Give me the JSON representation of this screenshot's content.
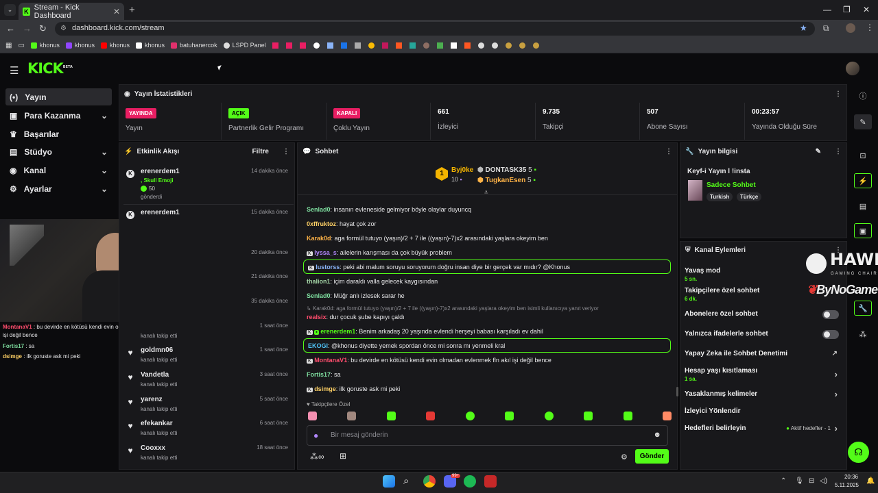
{
  "browser": {
    "tab_title": "Stream - Kick Dashboard",
    "url": "dashboard.kick.com/stream",
    "bookmarks": [
      {
        "label": "khonus",
        "color": "#53fc18"
      },
      {
        "label": "khonus",
        "color": "#9146ff"
      },
      {
        "label": "khonus",
        "color": "#ff0000"
      },
      {
        "label": "khonus",
        "color": "#ffffff"
      },
      {
        "label": "batuhanercok",
        "color": "#e1306c"
      },
      {
        "label": "LSPD Panel",
        "color": "#dddddd"
      }
    ]
  },
  "sidebar": {
    "items": [
      {
        "label": "Yayın",
        "icon": "broadcast-icon"
      },
      {
        "label": "Para Kazanma",
        "icon": "dollar-icon"
      },
      {
        "label": "Başarılar",
        "icon": "trophy-icon"
      },
      {
        "label": "Stüdyo",
        "icon": "studio-icon"
      },
      {
        "label": "Kanal",
        "icon": "user-icon"
      },
      {
        "label": "Ayarlar",
        "icon": "gear-icon"
      }
    ]
  },
  "logo": "KICK",
  "logo_sup": "BETA",
  "stats": {
    "title": "Yayın İstatistikleri",
    "cells": [
      {
        "badge": "YAYINDA",
        "badge_color": "#e91e63",
        "label": "Yayın"
      },
      {
        "badge": "AÇIK",
        "badge_color": "#53fc18",
        "label": "Partnerlik Gelir Programı"
      },
      {
        "badge": "KAPALI",
        "badge_color": "#e91e63",
        "label": "Çoklu Yayın"
      },
      {
        "value": "661",
        "label": "İzleyici"
      },
      {
        "value": "9.735",
        "label": "Takipçi"
      },
      {
        "value": "507",
        "label": "Abone Sayısı"
      },
      {
        "value": "00:23:57",
        "label": "Yayında Olduğu Süre"
      }
    ]
  },
  "activity": {
    "title": "Etkinlik Akışı",
    "filter": "Filtre",
    "items": [
      {
        "name": "erenerdem1",
        "time": "14 dakika önce",
        "sub": "gönderdi"
      },
      {
        "name": "erenerdem1",
        "time": "15 dakika önce",
        "sub": ""
      },
      {
        "name": "",
        "time": "20 dakika önce",
        "sub": ""
      },
      {
        "name": "",
        "time": "21 dakika önce",
        "sub": ""
      },
      {
        "name": "",
        "time": "35 dakika önce",
        "sub": ""
      },
      {
        "name": "",
        "time": "1 saat önce",
        "sub": "kanalı takip etti"
      },
      {
        "name": "goldmn06",
        "time": "1 saat önce",
        "sub": "kanalı takip etti"
      },
      {
        "name": "Vandetla",
        "time": "3 saat önce",
        "sub": "kanalı takip etti"
      },
      {
        "name": "yarenz",
        "time": "5 saat önce",
        "sub": "kanalı takip etti"
      },
      {
        "name": "efekankar",
        "time": "6 saat önce",
        "sub": "kanalı takip etti"
      },
      {
        "name": "Cooxxx",
        "time": "18 saat önce",
        "sub": "kanalı takip etti"
      }
    ],
    "gift_line": ", Skull Emoji",
    "gift_count": "50"
  },
  "chat": {
    "title": "Sohbet",
    "top": [
      {
        "rank": "1",
        "name": "Byj0ke",
        "count": "10"
      },
      {
        "name": "DONTASK35",
        "count": "5"
      },
      {
        "name": "TugkanEsen",
        "count": "5"
      }
    ],
    "messages": [
      {
        "user": "Senlad0",
        "color": "#7fdfa0",
        "text": "insanın evleneside gelmiyor böyle olaylar duyuncq",
        "hl": false
      },
      {
        "user": "0xffruktoz",
        "color": "#ffd166",
        "text": "hayat çok zor",
        "hl": false
      },
      {
        "user": "Karak0d",
        "color": "#ffb347",
        "text": "aga formül tutuyo (yaşın)/2 + 7 ile ((yaşın)-7)x2 arasındaki yaşlara okeyim ben",
        "hl": false
      },
      {
        "user": "lyssa_s",
        "color": "#b388ff",
        "text": "ailelerin karışması da çok büyük problem",
        "hl": false
      },
      {
        "user": "lustorss",
        "color": "#8ab4f8",
        "text": "peki abi malum soruyu soruyorum doğru insan diye bir gerçek var mıdır? @Khonus",
        "hl": true
      },
      {
        "user": "thalion1",
        "color": "#a5d6a7",
        "text": "içim daraldı valla gelecek kaygısından",
        "hl": false
      },
      {
        "user": "Senlad0",
        "color": "#7fdfa0",
        "text": "Müğr anlı izlesek sarar he",
        "hl": false
      },
      {
        "user": "realsix",
        "color": "#ff4d6d",
        "text": "dur çocuk şube kapıyı çaldı",
        "hl": false
      },
      {
        "user": "erenerdem1",
        "color": "#53fc18",
        "text": "Benim arkadaş 20 yaşında evlendi herşeyi babası karşıladı ev dahil",
        "hl": false
      },
      {
        "user": "EKOGI",
        "color": "#4fc3f7",
        "text": "@khonus diyette yemek spordan önce mi sonra mı yenmeli kral",
        "hl": true
      },
      {
        "user": "MontanaV1",
        "color": "#ff4d6d",
        "text": "bu devirde en kötüsü kendi evin olmadan evlenmek fln akıl işi değil bence",
        "hl": false
      },
      {
        "user": "Fortis17",
        "color": "#7fdfa0",
        "text": "sa",
        "hl": false
      },
      {
        "user": "dsimge",
        "color": "#ffd166",
        "text": "ilk goruste ask mi peki",
        "hl": false
      }
    ],
    "reply_preview": "Karak0d: aga formül tutuyo (yaşın)/2 + 7 ile ((yaşın)-7)x2 arasındaki yaşlara okeyim ben isimli kullanıcıya yanıt veriyor",
    "emote_header": "Takipçilere Özel",
    "input_placeholder": "Bir mesaj gönderin",
    "send": "Gönder"
  },
  "overlay_chat": [
    {
      "user": "MontanaV1",
      "color": "#ff4d6d",
      "text": "bu devirde en kötüsü kendi evin olmadan evlenmek fln akıl işi değil bence"
    },
    {
      "user": "Fortis17",
      "color": "#7fdfa0",
      "text": "sa"
    },
    {
      "user": "dsimge",
      "color": "#ffd166",
      "text": "ilk goruste ask mi peki"
    }
  ],
  "stream_info": {
    "title": "Yayın bilgisi",
    "stream_title": "Keyf-i Yayın l !insta",
    "category": "Sadece Sohbet",
    "tags": [
      "Turkish",
      "Türkçe"
    ]
  },
  "channel_actions": {
    "title": "Kanal Eylemleri",
    "items": [
      {
        "label": "Yavaş mod",
        "sub": "5 sn."
      },
      {
        "label": "Takipçilere özel sohbet",
        "sub": "6 dk."
      },
      {
        "label": "Abonelere özel sohbet",
        "sub": ""
      },
      {
        "label": "Yalnızca ifadelerle sohbet",
        "sub": ""
      },
      {
        "label": "Yapay Zeka ile Sohbet Denetimi",
        "sub": ""
      },
      {
        "label": "Hesap yaşı kısıtlaması",
        "sub": "1 sa."
      },
      {
        "label": "Yasaklanmış kelimeler",
        "sub": ""
      },
      {
        "label": "İzleyici Yönlendir",
        "sub": ""
      },
      {
        "label": "Hedefleri belirleyin",
        "sub": ""
      }
    ],
    "goals_status": "Aktif hedefler - 1"
  },
  "watermark": {
    "top": "HAWK",
    "mid": "GAMING CHAIR",
    "bottom": "ByNoGame"
  },
  "taskbar": {
    "time": "20:36",
    "date": "5.11.2025",
    "discord_badge": "99+"
  }
}
